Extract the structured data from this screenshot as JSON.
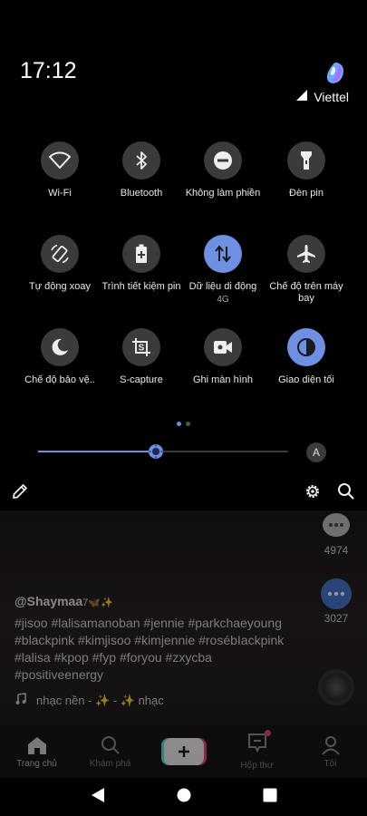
{
  "status": {
    "time": "17:12",
    "carrier": "Viettel"
  },
  "tiles": [
    {
      "label": "Wi-Fi",
      "icon": "wifi-icon",
      "active": false
    },
    {
      "label": "Bluetooth",
      "icon": "bluetooth-icon",
      "active": false
    },
    {
      "label": "Không làm phiền",
      "icon": "do-not-disturb-icon",
      "active": false
    },
    {
      "label": "Đèn pin",
      "icon": "flashlight-icon",
      "active": false
    },
    {
      "label": "Tự động xoay",
      "icon": "auto-rotate-icon",
      "active": false
    },
    {
      "label": "Trình tiết kiệm pin",
      "icon": "battery-saver-icon",
      "active": false
    },
    {
      "label": "Dữ liệu di động",
      "sub": "4G",
      "icon": "mobile-data-icon",
      "active": true
    },
    {
      "label": "Chế độ trên máy bay",
      "icon": "airplane-icon",
      "active": false
    },
    {
      "label": "Chế độ bảo vệ..",
      "icon": "eye-comfort-icon",
      "active": false
    },
    {
      "label": "S-capture",
      "icon": "s-capture-icon",
      "active": false
    },
    {
      "label": "Ghi màn hình",
      "icon": "screen-record-icon",
      "active": false
    },
    {
      "label": "Giao diện tối",
      "icon": "dark-mode-icon",
      "active": true
    }
  ],
  "brightness": {
    "level": 0.47,
    "auto_label": "A"
  },
  "accent": "#6f8fe3",
  "background_app": {
    "comment_count": "4974",
    "share_count": "3027",
    "username": "@Shaymaa",
    "username_suffix": "7🦋✨",
    "caption": "#jisoo #lalisamanoban #jennie #parkchaeyoung #blackpink #kimjisoo #kimjennie #rosébIackpink #lalisa #kpop #fyp #foryou #zxycba #positiveenergy",
    "music": "nhạc nền - ✨ - ✨      nhạc",
    "tabs": [
      {
        "label": "Trang chủ",
        "icon": "home-icon"
      },
      {
        "label": "Khám phá",
        "icon": "discover-icon"
      },
      {
        "label": "",
        "icon": "add-icon"
      },
      {
        "label": "Hộp thư",
        "icon": "inbox-icon"
      },
      {
        "label": "Tôi",
        "icon": "profile-icon"
      }
    ]
  }
}
